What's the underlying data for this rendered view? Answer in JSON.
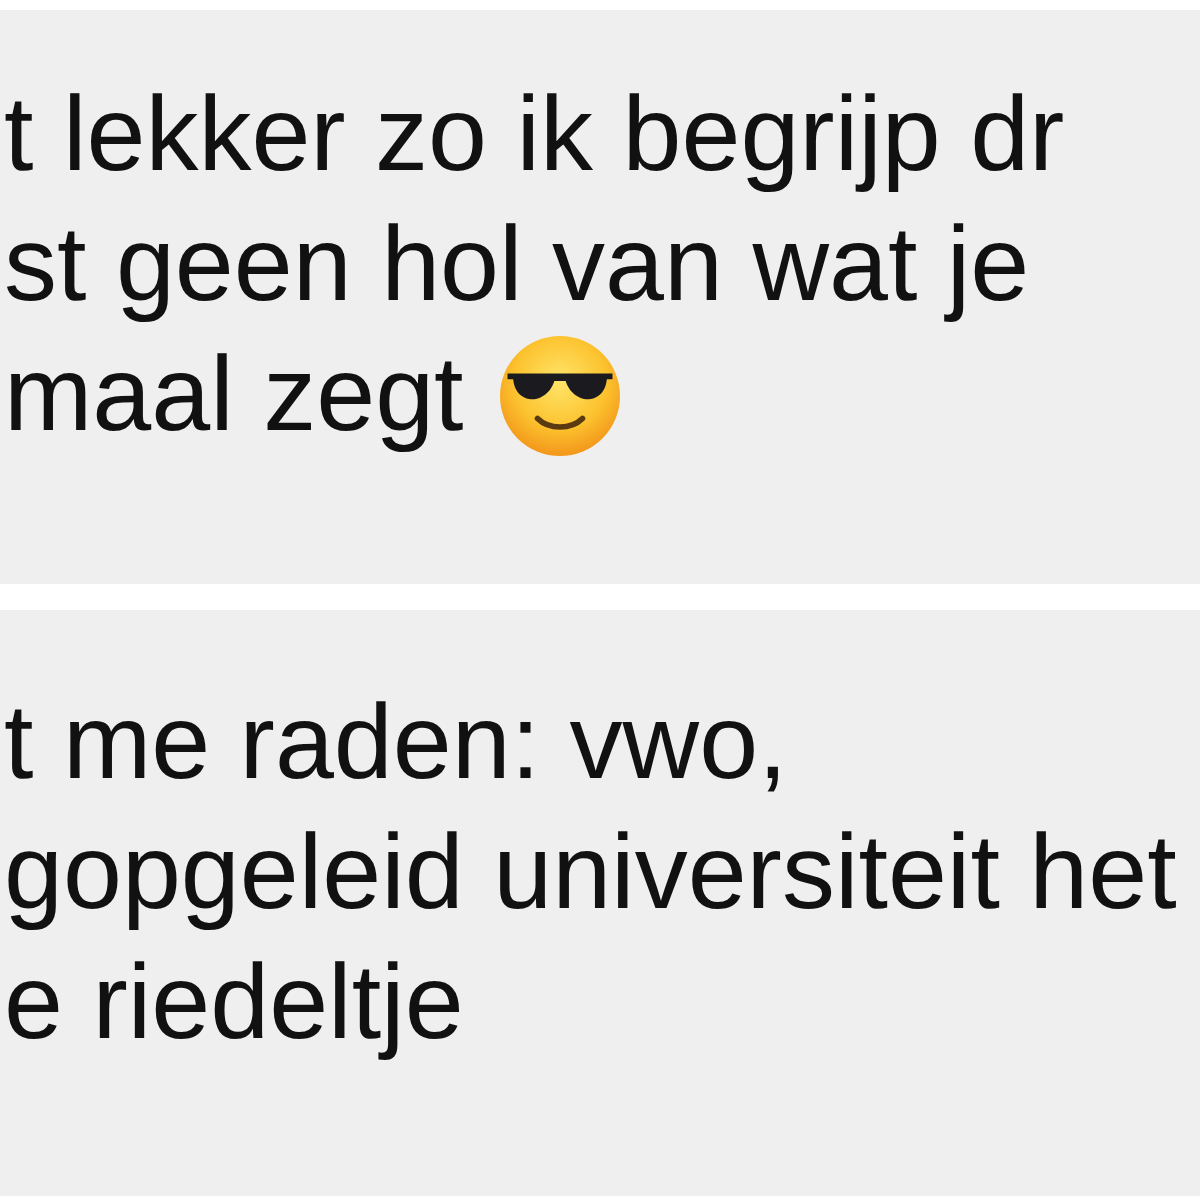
{
  "messages": [
    {
      "lines": [
        "t lekker zo ik begrijp dr",
        "st geen hol van wat je",
        "maal zegt"
      ],
      "emoji": true
    },
    {
      "lines": [
        "t me raden: vwo,",
        "gopgeleid universiteit het",
        "e riedeltje"
      ],
      "emoji": false
    }
  ]
}
